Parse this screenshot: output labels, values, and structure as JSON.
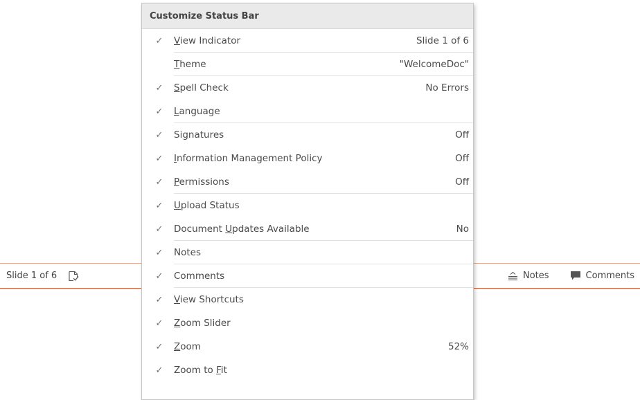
{
  "status_bar": {
    "slide_indicator": "Slide 1 of 6",
    "spell_check_icon": "spell-check-icon",
    "notes_label": "Notes",
    "notes_icon": "notes-icon",
    "comments_label": "Comments",
    "comments_icon": "comments-icon",
    "accent_color": "#c9522c"
  },
  "menu": {
    "title": "Customize Status Bar",
    "check_glyph": "✓",
    "items": [
      {
        "pre": "",
        "key": "V",
        "post": "iew Indicator",
        "value": "Slide 1 of 6",
        "checked": true
      },
      {
        "pre": "",
        "key": "T",
        "post": "heme",
        "value": "\"WelcomeDoc\"",
        "checked": false
      },
      {
        "pre": "",
        "key": "S",
        "post": "pell Check",
        "value": "No Errors",
        "checked": true
      },
      {
        "pre": "",
        "key": "L",
        "post": "anguage",
        "value": "",
        "checked": true
      },
      {
        "pre": "Si",
        "key": "g",
        "post": "natures",
        "value": "Off",
        "checked": true
      },
      {
        "pre": "",
        "key": "I",
        "post": "nformation Management Policy",
        "value": "Off",
        "checked": true
      },
      {
        "pre": "",
        "key": "P",
        "post": "ermissions",
        "value": "Off",
        "checked": true
      },
      {
        "pre": "",
        "key": "U",
        "post": "pload Status",
        "value": "",
        "checked": true
      },
      {
        "pre": "Document ",
        "key": "U",
        "post": "pdates Available",
        "value": "No",
        "checked": true
      },
      {
        "pre": "Notes",
        "key": "",
        "post": "",
        "value": "",
        "checked": true
      },
      {
        "pre": "Comments",
        "key": "",
        "post": "",
        "value": "",
        "checked": true
      },
      {
        "pre": "",
        "key": "V",
        "post": "iew Shortcuts",
        "value": "",
        "checked": true
      },
      {
        "pre": "",
        "key": "Z",
        "post": "oom Slider",
        "value": "",
        "checked": true
      },
      {
        "pre": "",
        "key": "Z",
        "post": "oom",
        "value": "52%",
        "checked": true
      },
      {
        "pre": "Zoom to ",
        "key": "F",
        "post": "it",
        "value": "",
        "checked": true
      }
    ]
  }
}
